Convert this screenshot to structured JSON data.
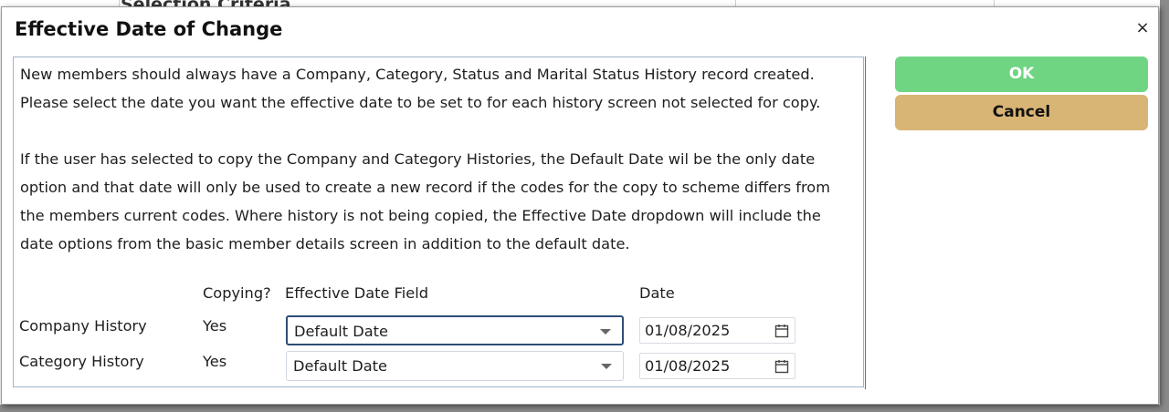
{
  "background": {
    "header_text": "Selection Criteria"
  },
  "dialog": {
    "title": "Effective Date of Change",
    "close_symbol": "×",
    "paragraph1": "New members should always have a Company, Category, Status and Marital Status History record created. Please select the date you want the effective date to be set to for each history screen not selected for copy.",
    "paragraph2": "If the user has selected to copy the Company and Category Histories, the Default Date wil be the only date option and that date will only be used to create a new record if the codes for the copy to scheme differs from the members current codes. Where history is not being copied, the Effective Date dropdown will include the date options from the basic member details screen in addition to the default date.",
    "columns": {
      "copying": "Copying?",
      "effective_date_field": "Effective Date Field",
      "date": "Date"
    },
    "rows": [
      {
        "label": "Company History",
        "copying": "Yes",
        "effective_date_field": "Default Date",
        "date": "01/08/2025"
      },
      {
        "label": "Category History",
        "copying": "Yes",
        "effective_date_field": "Default Date",
        "date": "01/08/2025"
      }
    ],
    "buttons": {
      "ok": "OK",
      "cancel": "Cancel"
    }
  },
  "colors": {
    "ok_button": "#6fd582",
    "cancel_button": "#d8b574",
    "focus_border": "#2d4e77"
  },
  "icons": {
    "close": "close-icon",
    "calendar": "calendar-icon",
    "dropdown": "chevron-down-icon"
  }
}
